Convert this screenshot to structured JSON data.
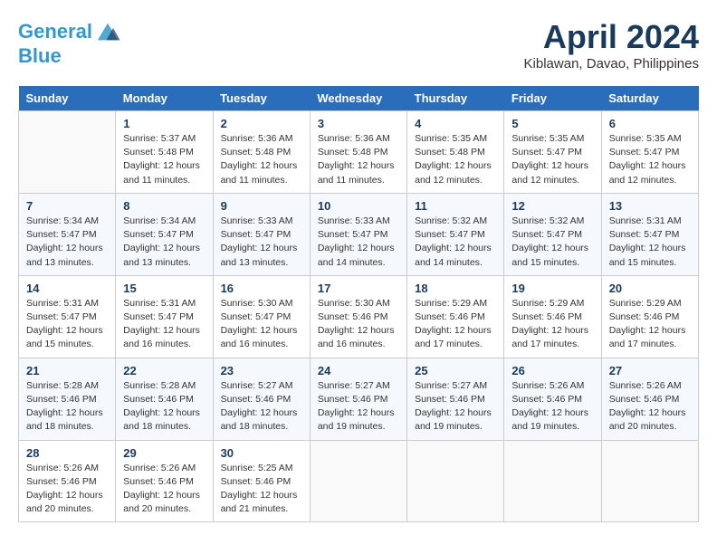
{
  "header": {
    "logo_line1": "General",
    "logo_line2": "Blue",
    "month": "April 2024",
    "location": "Kiblawan, Davao, Philippines"
  },
  "columns": [
    "Sunday",
    "Monday",
    "Tuesday",
    "Wednesday",
    "Thursday",
    "Friday",
    "Saturday"
  ],
  "weeks": [
    [
      {
        "day": "",
        "info": ""
      },
      {
        "day": "1",
        "info": "Sunrise: 5:37 AM\nSunset: 5:48 PM\nDaylight: 12 hours\nand 11 minutes."
      },
      {
        "day": "2",
        "info": "Sunrise: 5:36 AM\nSunset: 5:48 PM\nDaylight: 12 hours\nand 11 minutes."
      },
      {
        "day": "3",
        "info": "Sunrise: 5:36 AM\nSunset: 5:48 PM\nDaylight: 12 hours\nand 11 minutes."
      },
      {
        "day": "4",
        "info": "Sunrise: 5:35 AM\nSunset: 5:48 PM\nDaylight: 12 hours\nand 12 minutes."
      },
      {
        "day": "5",
        "info": "Sunrise: 5:35 AM\nSunset: 5:47 PM\nDaylight: 12 hours\nand 12 minutes."
      },
      {
        "day": "6",
        "info": "Sunrise: 5:35 AM\nSunset: 5:47 PM\nDaylight: 12 hours\nand 12 minutes."
      }
    ],
    [
      {
        "day": "7",
        "info": "Sunrise: 5:34 AM\nSunset: 5:47 PM\nDaylight: 12 hours\nand 13 minutes."
      },
      {
        "day": "8",
        "info": "Sunrise: 5:34 AM\nSunset: 5:47 PM\nDaylight: 12 hours\nand 13 minutes."
      },
      {
        "day": "9",
        "info": "Sunrise: 5:33 AM\nSunset: 5:47 PM\nDaylight: 12 hours\nand 13 minutes."
      },
      {
        "day": "10",
        "info": "Sunrise: 5:33 AM\nSunset: 5:47 PM\nDaylight: 12 hours\nand 14 minutes."
      },
      {
        "day": "11",
        "info": "Sunrise: 5:32 AM\nSunset: 5:47 PM\nDaylight: 12 hours\nand 14 minutes."
      },
      {
        "day": "12",
        "info": "Sunrise: 5:32 AM\nSunset: 5:47 PM\nDaylight: 12 hours\nand 15 minutes."
      },
      {
        "day": "13",
        "info": "Sunrise: 5:31 AM\nSunset: 5:47 PM\nDaylight: 12 hours\nand 15 minutes."
      }
    ],
    [
      {
        "day": "14",
        "info": "Sunrise: 5:31 AM\nSunset: 5:47 PM\nDaylight: 12 hours\nand 15 minutes."
      },
      {
        "day": "15",
        "info": "Sunrise: 5:31 AM\nSunset: 5:47 PM\nDaylight: 12 hours\nand 16 minutes."
      },
      {
        "day": "16",
        "info": "Sunrise: 5:30 AM\nSunset: 5:47 PM\nDaylight: 12 hours\nand 16 minutes."
      },
      {
        "day": "17",
        "info": "Sunrise: 5:30 AM\nSunset: 5:46 PM\nDaylight: 12 hours\nand 16 minutes."
      },
      {
        "day": "18",
        "info": "Sunrise: 5:29 AM\nSunset: 5:46 PM\nDaylight: 12 hours\nand 17 minutes."
      },
      {
        "day": "19",
        "info": "Sunrise: 5:29 AM\nSunset: 5:46 PM\nDaylight: 12 hours\nand 17 minutes."
      },
      {
        "day": "20",
        "info": "Sunrise: 5:29 AM\nSunset: 5:46 PM\nDaylight: 12 hours\nand 17 minutes."
      }
    ],
    [
      {
        "day": "21",
        "info": "Sunrise: 5:28 AM\nSunset: 5:46 PM\nDaylight: 12 hours\nand 18 minutes."
      },
      {
        "day": "22",
        "info": "Sunrise: 5:28 AM\nSunset: 5:46 PM\nDaylight: 12 hours\nand 18 minutes."
      },
      {
        "day": "23",
        "info": "Sunrise: 5:27 AM\nSunset: 5:46 PM\nDaylight: 12 hours\nand 18 minutes."
      },
      {
        "day": "24",
        "info": "Sunrise: 5:27 AM\nSunset: 5:46 PM\nDaylight: 12 hours\nand 19 minutes."
      },
      {
        "day": "25",
        "info": "Sunrise: 5:27 AM\nSunset: 5:46 PM\nDaylight: 12 hours\nand 19 minutes."
      },
      {
        "day": "26",
        "info": "Sunrise: 5:26 AM\nSunset: 5:46 PM\nDaylight: 12 hours\nand 19 minutes."
      },
      {
        "day": "27",
        "info": "Sunrise: 5:26 AM\nSunset: 5:46 PM\nDaylight: 12 hours\nand 20 minutes."
      }
    ],
    [
      {
        "day": "28",
        "info": "Sunrise: 5:26 AM\nSunset: 5:46 PM\nDaylight: 12 hours\nand 20 minutes."
      },
      {
        "day": "29",
        "info": "Sunrise: 5:26 AM\nSunset: 5:46 PM\nDaylight: 12 hours\nand 20 minutes."
      },
      {
        "day": "30",
        "info": "Sunrise: 5:25 AM\nSunset: 5:46 PM\nDaylight: 12 hours\nand 21 minutes."
      },
      {
        "day": "",
        "info": ""
      },
      {
        "day": "",
        "info": ""
      },
      {
        "day": "",
        "info": ""
      },
      {
        "day": "",
        "info": ""
      }
    ]
  ]
}
